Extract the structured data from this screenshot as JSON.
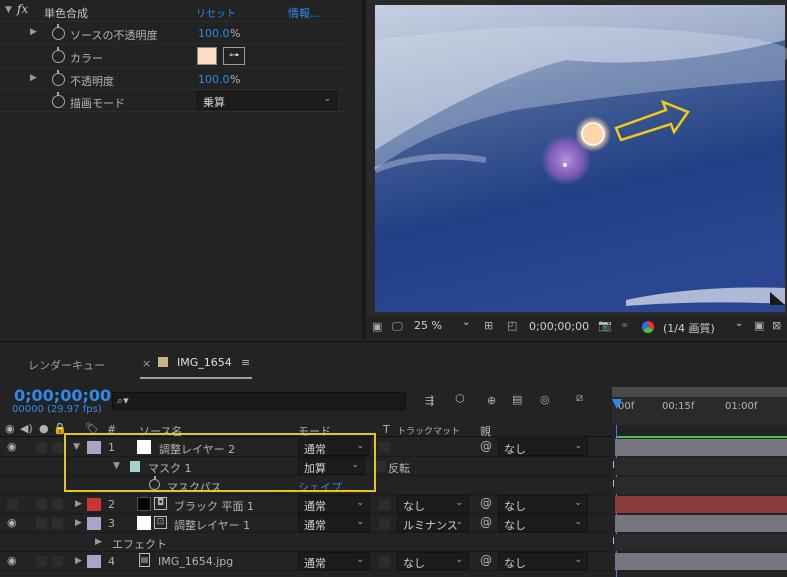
{
  "effect": {
    "fx_label": "fx",
    "name": "単色合成",
    "reset": "リセット",
    "info": "情報...",
    "props": [
      {
        "label": "ソースの不透明度",
        "value": "100.0",
        "unit": "%"
      },
      {
        "label": "カラー"
      },
      {
        "label": "不透明度",
        "value": "100.0",
        "unit": "%"
      },
      {
        "label": "描画モード",
        "value": "乗算"
      }
    ],
    "color_value": "#fcdcc4"
  },
  "viewer": {
    "zoom": "25 %",
    "timecode": "0;00;00;00",
    "resolution": "(1/4 画質)"
  },
  "timeline": {
    "tab_render": "レンダーキュー",
    "tab_close": "×",
    "tab_comp": "IMG_1654",
    "tab_menu": "≡",
    "current_time": "0;00;00;00",
    "frame_info": "00000 (29.97 fps)",
    "search_placeholder": "",
    "headers": {
      "num": "#",
      "source": "ソース名",
      "mode": "モード",
      "t": "T",
      "trkmat": "トラックマット",
      "parent": "親"
    },
    "ruler": [
      "00f",
      "00:15f",
      "01:00f"
    ],
    "layers": [
      {
        "num": "1",
        "name": "調整レイヤー 2",
        "mode": "通常",
        "parent": "なし",
        "color": "#a9a5c6"
      },
      {
        "mask_name": "マスク 1",
        "mask_mode": "加算",
        "invert": "反転"
      },
      {
        "mask_path": "マスクパス",
        "mask_shape": "シェイプ..."
      },
      {
        "num": "2",
        "name": "ブラック 平面 1",
        "mode": "通常",
        "trkmat": "なし",
        "parent": "なし",
        "color": "#cc3333"
      },
      {
        "num": "3",
        "name": "調整レイヤー 1",
        "mode": "通常",
        "trkmat": "ルミナンス",
        "parent": "なし",
        "color": "#a9a5c6"
      },
      {
        "effect_label": "エフェクト"
      },
      {
        "num": "4",
        "name": "IMG_1654.jpg",
        "mode": "通常",
        "trkmat": "なし",
        "parent": "なし",
        "color": "#a9a5c6"
      }
    ]
  }
}
